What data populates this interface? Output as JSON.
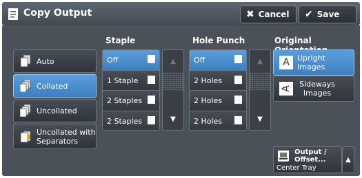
{
  "header": {
    "title": "Copy Output",
    "cancel_label": "Cancel",
    "save_label": "Save"
  },
  "output_modes": [
    {
      "label": "Auto",
      "selected": false
    },
    {
      "label": "Collated",
      "selected": true
    },
    {
      "label": "Uncollated",
      "selected": false
    },
    {
      "label": "Uncollated with Separators",
      "selected": false
    }
  ],
  "staple": {
    "title": "Staple",
    "options": [
      {
        "label": "Off",
        "selected": true
      },
      {
        "label": "1 Staple",
        "selected": false
      },
      {
        "label": "2 Staples",
        "selected": false
      },
      {
        "label": "2 Staples",
        "selected": false
      }
    ]
  },
  "hole_punch": {
    "title": "Hole Punch",
    "options": [
      {
        "label": "Off",
        "selected": true
      },
      {
        "label": "2 Holes",
        "selected": false
      },
      {
        "label": "2 Holes",
        "selected": false
      },
      {
        "label": "2 Holes",
        "selected": false
      }
    ]
  },
  "orientation": {
    "title": "Original Orientation",
    "options": [
      {
        "label": "Upright Images",
        "icon": "A",
        "selected": true
      },
      {
        "label": "Sideways Images",
        "icon": "A",
        "selected": false
      }
    ]
  },
  "output": {
    "label": "Output / Offset...",
    "value": "Center Tray"
  },
  "colors": {
    "accent": "#4a8fd2",
    "panel": "#4b5159"
  }
}
